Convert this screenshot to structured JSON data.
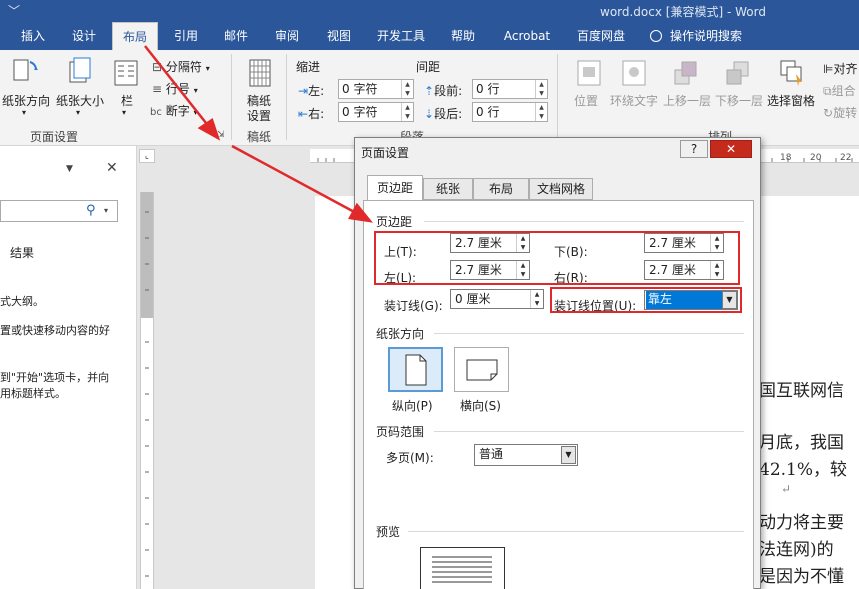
{
  "window": {
    "title": "word.docx [兼容模式] - Word"
  },
  "tabs": [
    {
      "label": "插入"
    },
    {
      "label": "设计"
    },
    {
      "label": "布局"
    },
    {
      "label": "引用"
    },
    {
      "label": "邮件"
    },
    {
      "label": "审阅"
    },
    {
      "label": "视图"
    },
    {
      "label": "开发工具"
    },
    {
      "label": "帮助"
    },
    {
      "label": "Acrobat"
    },
    {
      "label": "百度网盘"
    },
    {
      "label": "操作说明搜索"
    }
  ],
  "ribbon": {
    "orientation": "纸张方向",
    "size": "纸张大小",
    "columns": "栏",
    "breaks": "分隔符",
    "line_numbers": "行号",
    "hyphenation": "断字",
    "page_setup_group": "页面设置",
    "manuscript": "稿纸\n设置",
    "manuscript_l1": "稿纸",
    "manuscript_l2": "设置",
    "manuscript_group": "稿纸",
    "indent_label": "缩进",
    "spacing_label": "间距",
    "indent_left_label": "左:",
    "indent_left_value": "0 字符",
    "indent_right_label": "右:",
    "indent_right_value": "0 字符",
    "space_before_label": "段前:",
    "space_before_value": "0 行",
    "space_after_label": "段后:",
    "space_after_value": "0 行",
    "paragraph_group": "段落",
    "position": "位置",
    "wrap_text": "环绕文字",
    "bring_forward": "上移一层",
    "send_backward": "下移一层",
    "selection_pane": "选择窗格",
    "align": "对齐",
    "group": "组合",
    "rotate": "旋转",
    "arrange_group": "排列"
  },
  "navpane": {
    "results_label": "结果",
    "line1": "式大纲。",
    "line2": "置或快速移动内容的好",
    "line3": "到\"开始\"选项卡，并向",
    "line4": "用标题样式。"
  },
  "document": {
    "line1": "国互联网信",
    "line2": "月底，我国",
    "line3": "42.1%，较",
    "line4": "动力将主要",
    "line5": "法连网)的",
    "line6": "是因为不懂"
  },
  "dialog": {
    "title": "页面设置",
    "help": "?",
    "close": "✕",
    "tabs": [
      {
        "label": "页边距"
      },
      {
        "label": "纸张"
      },
      {
        "label": "布局"
      },
      {
        "label": "文档网格"
      }
    ],
    "margins_section": "页边距",
    "top_label": "上(T):",
    "top_value": "2.7 厘米",
    "bottom_label": "下(B):",
    "bottom_value": "2.7 厘米",
    "left_label": "左(L):",
    "left_value": "2.7 厘米",
    "right_label": "右(R):",
    "right_value": "2.7 厘米",
    "gutter_label": "装订线(G):",
    "gutter_value": "0 厘米",
    "gutter_pos_label": "装订线位置(U):",
    "gutter_pos_value": "靠左",
    "orientation_section": "纸张方向",
    "portrait_label": "纵向(P)",
    "landscape_label": "横向(S)",
    "pages_section": "页码范围",
    "multiple_pages_label": "多页(M):",
    "multiple_pages_value": "普通",
    "preview_section": "预览"
  },
  "colors": {
    "ribbon_blue": "#2b579a",
    "highlight": "#e0292b",
    "select": "#0078d7"
  }
}
